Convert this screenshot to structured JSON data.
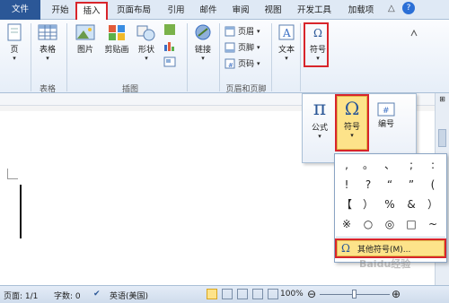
{
  "tabs": [
    "文件",
    "开始",
    "插入",
    "页面布局",
    "引用",
    "邮件",
    "审阅",
    "视图",
    "开发工具",
    "加载项"
  ],
  "ribbon": {
    "page_label": "页",
    "table_label": "表格",
    "picture_label": "图片",
    "clipart_label": "剪贴画",
    "shapes_label": "形状",
    "link_label": "链接",
    "header_label": "页眉",
    "footer_label": "页脚",
    "pagenum_label": "页码",
    "textbox_label": "文本",
    "symbol_label": "符号",
    "group_table": "表格",
    "group_illustrations": "插图",
    "group_header_footer": "页眉和页脚"
  },
  "dropdown1": {
    "equation_label": "公式",
    "symbol_label": "符号",
    "number_label": "编号"
  },
  "symbols": [
    ",",
    "。",
    "、",
    ";",
    ":",
    "!",
    "?",
    "“",
    "”",
    "(",
    "【",
    "）",
    "%",
    "&",
    "）",
    "※",
    "○",
    "◎",
    "□",
    "~"
  ],
  "more_symbols_label": "其他符号(M)...",
  "watermark": "Baidu经验",
  "status": {
    "page": "页面: 1/1",
    "words": "字数: 0",
    "lang": "英语(美国)",
    "zoom": "100%"
  },
  "colors": {
    "accent": "#2b5797",
    "highlight": "#d8252b",
    "selected": "#fde38a"
  }
}
